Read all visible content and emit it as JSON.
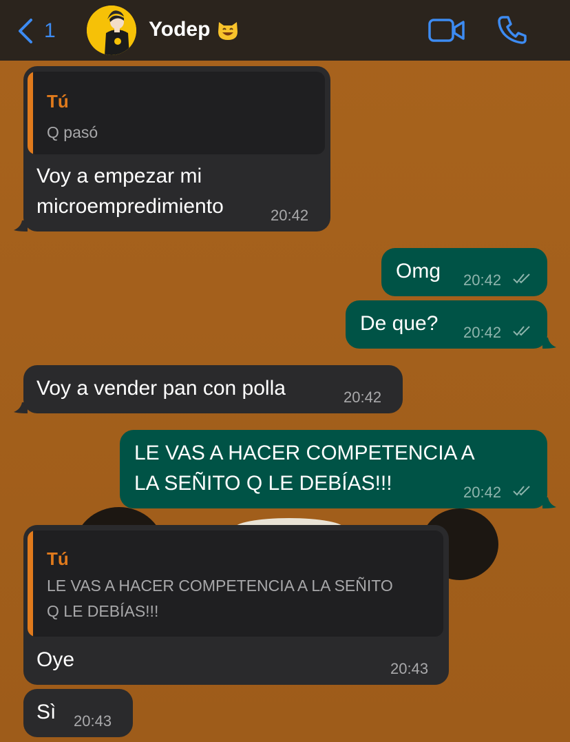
{
  "header": {
    "back_count": "1",
    "contact_name": "Yodep",
    "contact_emoji": "smiling-cat-emoji",
    "icons": [
      "chevron-left-icon",
      "video-call-icon",
      "phone-call-icon"
    ]
  },
  "colors": {
    "accent": "#3d8bf2",
    "incoming_bubble": "#2a2a2c",
    "outgoing_bubble": "#005346",
    "quote_author": "#e07a1c",
    "wallpaper": "#a05e1a"
  },
  "messages": [
    {
      "direction": "incoming",
      "reply_to": {
        "author": "Tú",
        "text": "Q pasó"
      },
      "lines": [
        "Voy a empezar mi",
        "microempredimiento"
      ],
      "time": "20:42"
    },
    {
      "direction": "outgoing",
      "lines": [
        "Omg"
      ],
      "time": "20:42",
      "status": "read"
    },
    {
      "direction": "outgoing",
      "lines": [
        "De que?"
      ],
      "time": "20:42",
      "status": "read"
    },
    {
      "direction": "incoming",
      "lines": [
        "Voy a vender pan con polla"
      ],
      "time": "20:42"
    },
    {
      "direction": "outgoing",
      "lines": [
        "LE VAS A HACER COMPETENCIA A",
        "LA SEÑITO Q LE DEBÍAS!!!"
      ],
      "time": "20:42",
      "status": "read"
    },
    {
      "direction": "incoming",
      "reply_to": {
        "author": "Tú",
        "lines": [
          "LE VAS A HACER COMPETENCIA A LA SEÑITO",
          "Q LE DEBÍAS!!!"
        ]
      },
      "lines": [
        "Oye"
      ],
      "time": "20:43"
    },
    {
      "direction": "incoming",
      "lines": [
        "Sì"
      ],
      "time": "20:43"
    }
  ]
}
